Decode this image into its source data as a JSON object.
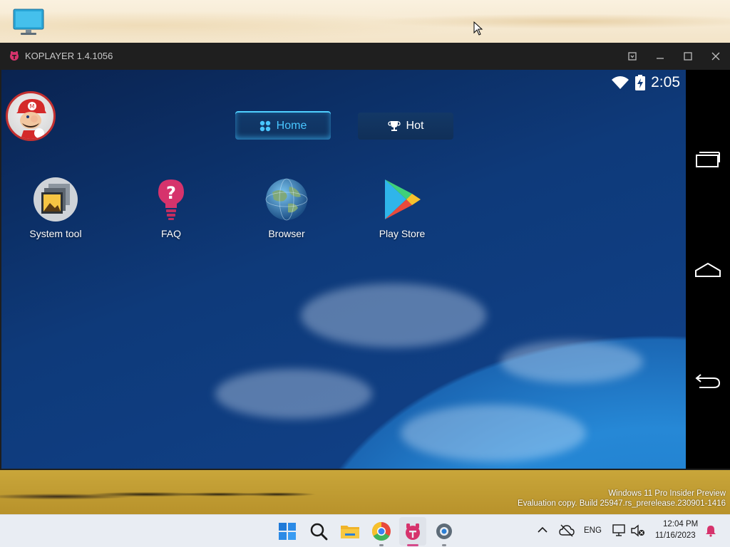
{
  "window": {
    "title": "KOPLAYER 1.4.1056"
  },
  "android": {
    "status": {
      "time": "2:05",
      "wifi_icon": "wifi-icon",
      "battery_icon": "battery-charging-icon"
    },
    "tabs": [
      {
        "label": "Home",
        "icon": "grid-icon",
        "active": true
      },
      {
        "label": "Hot",
        "icon": "trophy-icon",
        "active": false
      }
    ],
    "apps": [
      {
        "label": "System tool",
        "icon": "gallery-icon"
      },
      {
        "label": "FAQ",
        "icon": "question-bulb-icon"
      },
      {
        "label": "Browser",
        "icon": "globe-icon"
      },
      {
        "label": "Play Store",
        "icon": "play-store-icon"
      }
    ],
    "nav": [
      "recents-icon",
      "home-icon",
      "back-icon"
    ]
  },
  "desktop": {
    "watermark_line1": "Windows 11 Pro Insider Preview",
    "watermark_line2": "Evaluation copy. Build 25947.rs_prerelease.230901-1416"
  },
  "taskbar": {
    "language": "ENG",
    "time": "12:04 PM",
    "date": "11/16/2023"
  },
  "colors": {
    "tab_active": "#49c6ff",
    "koplayer_brand": "#d6336c",
    "taskbar_bg": "#e9edf3"
  }
}
